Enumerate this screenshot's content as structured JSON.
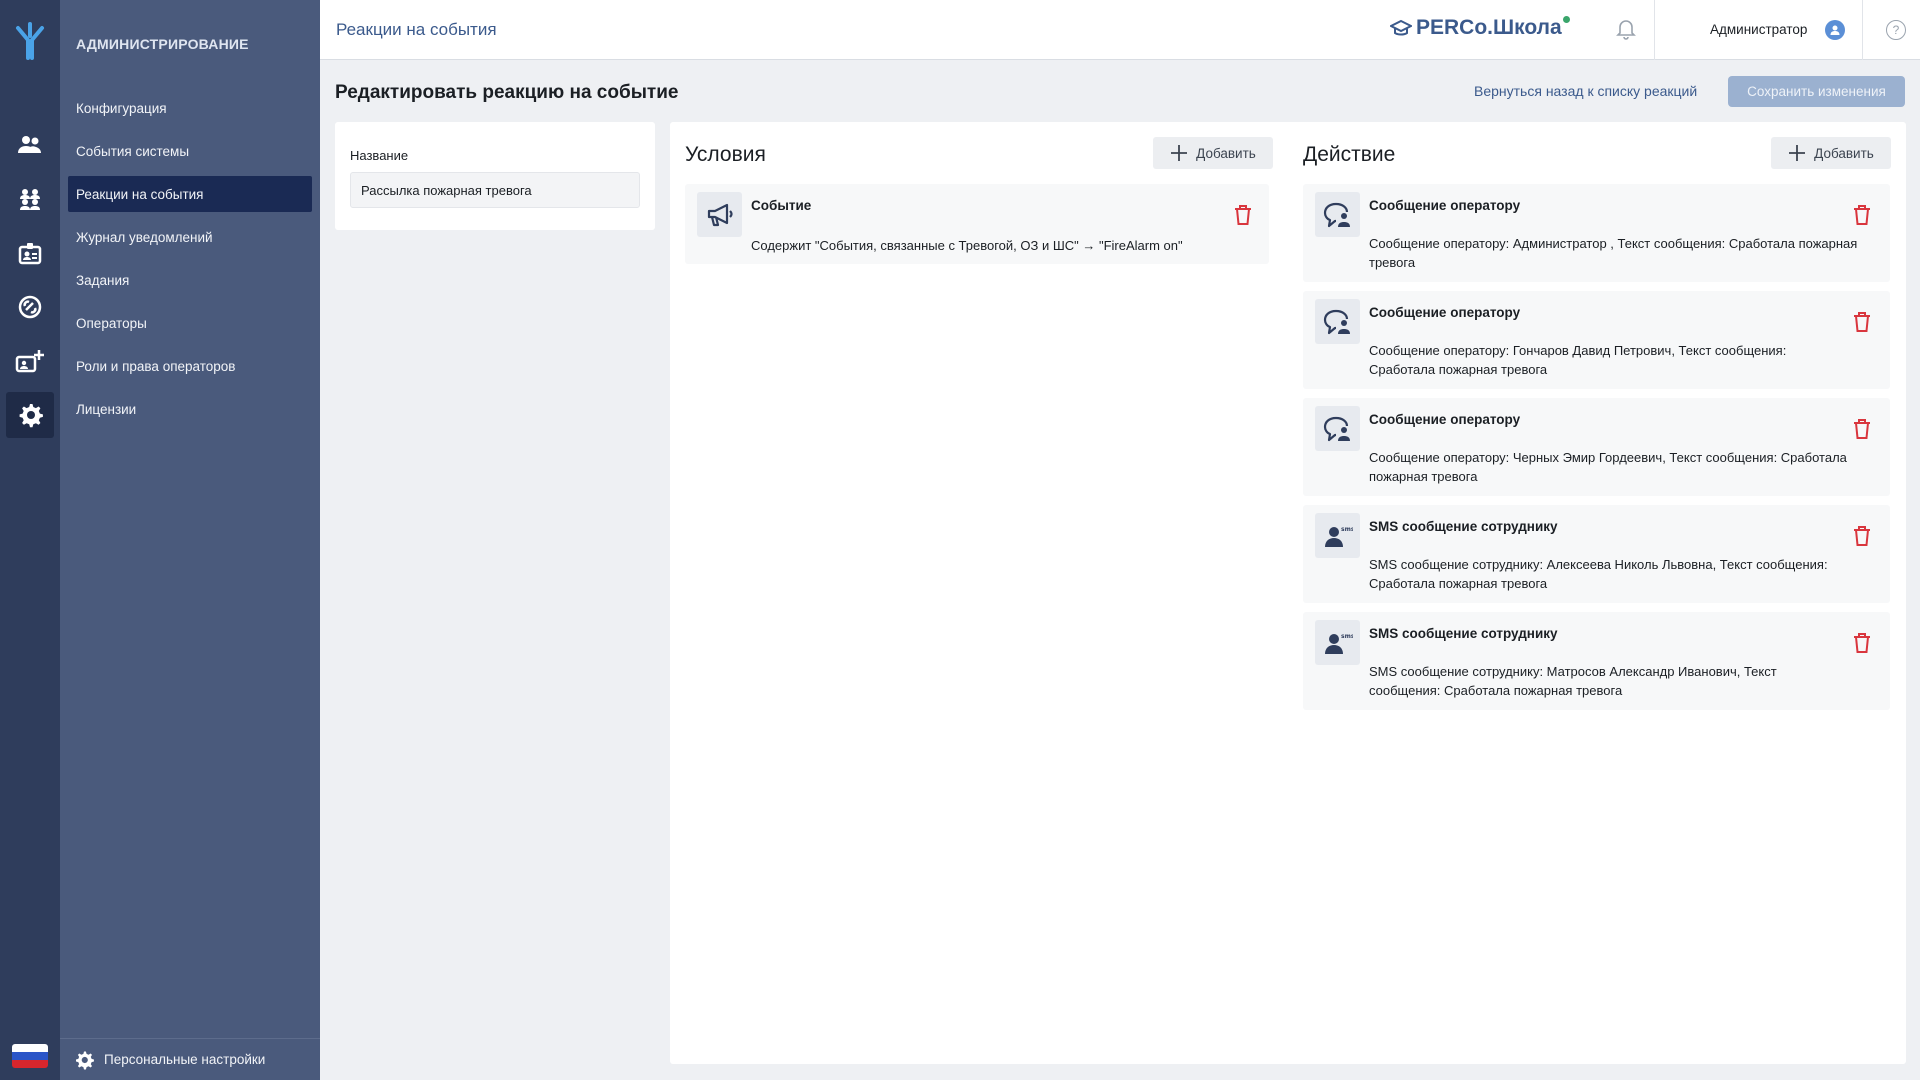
{
  "rail": {
    "icons": [
      "logo-icon",
      "users-icon",
      "groups-icon",
      "badge-icon",
      "link-icon",
      "add-badge-icon",
      "settings-icon",
      "flag-ru-icon"
    ],
    "active": "settings-icon",
    "flag_colors": [
      "#ffffff",
      "#2b55c7",
      "#d7262d"
    ]
  },
  "sidebar": {
    "title": "АДМИНИСТРИРОВАНИЕ",
    "items": [
      {
        "label": "Конфигурация"
      },
      {
        "label": "События системы"
      },
      {
        "label": "Реакции на события"
      },
      {
        "label": "Журнал уведомлений"
      },
      {
        "label": "Задания"
      },
      {
        "label": "Операторы"
      },
      {
        "label": "Роли и права операторов"
      },
      {
        "label": "Лицензии"
      }
    ],
    "active_index": 2,
    "footer_label": "Персональные настройки"
  },
  "header": {
    "page_title": "Реакции на события",
    "brand": "PERCo.Школа",
    "user": "Администратор",
    "help": "?"
  },
  "content": {
    "title": "Редактировать реакцию на событие",
    "back_link": "Вернуться назад к списку реакций",
    "save_label": "Сохранить изменения",
    "name_label": "Название",
    "name_value": "Рассылка пожарная тревога"
  },
  "conditions": {
    "title": "Условия",
    "add_label": "Добавить",
    "items": [
      {
        "title": "Событие",
        "desc": "Содержит \"События, связанные с Тревогой, ОЗ и ШС\" → \"FireAlarm on\"",
        "icon": "megaphone-icon"
      }
    ]
  },
  "actions": {
    "title": "Действие",
    "add_label": "Добавить",
    "items": [
      {
        "title": "Сообщение оператору",
        "desc": "Сообщение оператору: Администратор , Текст сообщения: Сработала пожарная тревога",
        "icon": "operator-message-icon"
      },
      {
        "title": "Сообщение оператору",
        "desc": "Сообщение оператору: Гончаров Давид Петрович, Текст сообщения: Сработала пожарная тревога",
        "icon": "operator-message-icon"
      },
      {
        "title": "Сообщение оператору",
        "desc": "Сообщение оператору: Черных Эмир Гордеевич, Текст сообщения: Сработала пожарная тревога",
        "icon": "operator-message-icon"
      },
      {
        "title": "SMS сообщение сотруднику",
        "desc": "SMS сообщение сотруднику: Алексеева Николь Львовна, Текст сообщения: Сработала пожарная тревога",
        "icon": "sms-employee-icon"
      },
      {
        "title": "SMS сообщение сотруднику",
        "desc": "SMS сообщение сотруднику: Матросов Александр Иванович, Текст сообщения: Сработала пожарная тревога",
        "icon": "sms-employee-icon"
      }
    ]
  },
  "colors": {
    "rail_bg": "#2f3d5c",
    "sidebar_bg": "#4a5a7c",
    "active_item_bg": "#1a2a54",
    "accent": "#3b5a8c",
    "delete": "#d9363e",
    "save_disabled": "#9bb1d0"
  }
}
